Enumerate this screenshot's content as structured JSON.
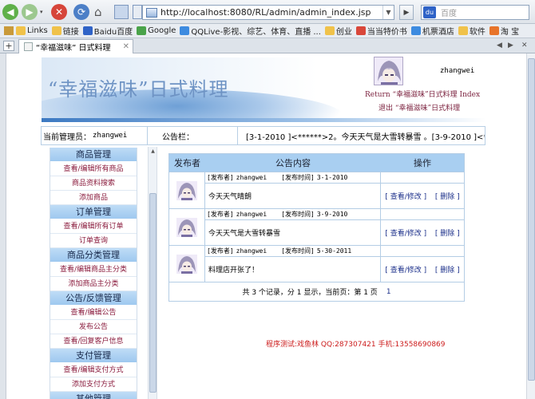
{
  "browser": {
    "url": "http://localhost:8080/RL/admin/admin_index.jsp",
    "search_placeholder": "百度",
    "search_engine_icon": "baidu-icon",
    "bookmarks": [
      {
        "label": "Links",
        "color": "#f0c24a"
      },
      {
        "label": "链接",
        "color": "#f0c24a"
      },
      {
        "label": "Baidu百度",
        "color": "#2f63c7"
      },
      {
        "label": "Google",
        "color": "#4aa34a"
      },
      {
        "label": "QQLive-影视、综艺、体育、直播 ...",
        "color": "#3d8be0"
      },
      {
        "label": "创业",
        "color": "#f0c24a"
      },
      {
        "label": "当当特价书",
        "color": "#d9473a"
      },
      {
        "label": "机票酒店",
        "color": "#3d8be0"
      },
      {
        "label": "软件",
        "color": "#f0c24a"
      },
      {
        "label": "淘 宝",
        "color": "#e8742a"
      }
    ],
    "tab_title": "“幸福滋味” 日式料理"
  },
  "header": {
    "banner_title": "“幸福滋味”日式料理",
    "admin_name": "zhangwei",
    "return_link": "Return “幸福滋味”日式料理 Index",
    "exit_link": "退出 “幸福滋味”日式料理"
  },
  "infobar": {
    "current_admin_label": "当前管理员：",
    "current_admin_name": "zhangwei",
    "notice_label": "公告栏：",
    "marquee": "[3-1-2010 ]<******>2。今天天气是大雪转暴雪 。[3-9-2010 ]<*"
  },
  "menu": {
    "sections": [
      {
        "title": "商品管理",
        "items": [
          "查看/编辑所有商品",
          "商品资料搜索",
          "添加商品"
        ]
      },
      {
        "title": "订单管理",
        "items": [
          "查看/编辑所有订单",
          "订单查询"
        ]
      },
      {
        "title": "商品分类管理",
        "items": [
          "查看/编辑商品主分类",
          "添加商品主分类"
        ]
      },
      {
        "title": "公告/反馈管理",
        "items": [
          "查看/编辑公告",
          "发布公告",
          "查看/回复客户信息"
        ]
      },
      {
        "title": "支付管理",
        "items": [
          "查看/编辑支付方式",
          "添加支付方式"
        ]
      },
      {
        "title": "其他管理",
        "items": []
      }
    ]
  },
  "table": {
    "headers": [
      "发布者",
      "公告内容",
      "操作"
    ],
    "publisher_label": "[发布者]",
    "time_label": "[发布时间]",
    "edit_label": "[ 查看/修改 ]",
    "delete_label": "[ 删除 ]",
    "rows": [
      {
        "publisher": "zhangwei",
        "time": "3-1-2010",
        "content": "今天天气晴朗"
      },
      {
        "publisher": "zhangwei",
        "time": "3-9-2010",
        "content": "今天天气是大雪转暴雪"
      },
      {
        "publisher": "zhangwei",
        "time": "5-30-2011",
        "content": "料理店开张了！"
      }
    ],
    "pager": {
      "text_a": "共 3 个记录，分 1 显示，当前页：第 1 页",
      "page": "1"
    }
  },
  "footer": "程序测试:戏鱼林 QQ:287307421 手机:13558690869"
}
